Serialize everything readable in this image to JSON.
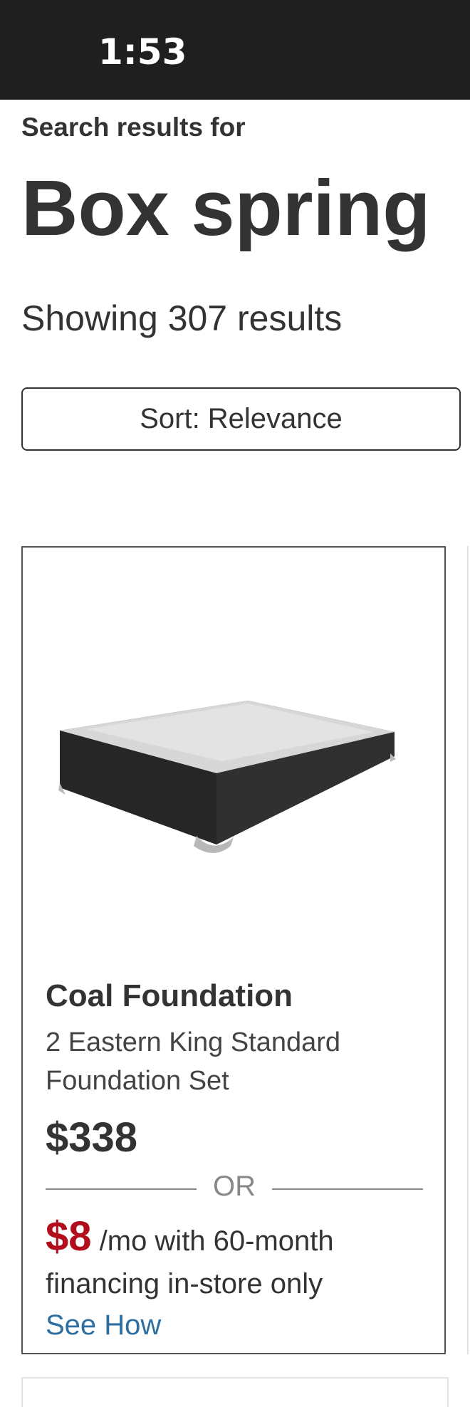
{
  "status_bar": {
    "time": "1:53"
  },
  "search": {
    "label": "Search results for",
    "query": "Box spring",
    "result_count": "Showing 307 results"
  },
  "sort": {
    "label": "Sort: Relevance"
  },
  "products": [
    {
      "name": "Coal Foundation",
      "description": "2 Eastern King Standard Foundation Set",
      "price": "$338",
      "or_text": "OR",
      "monthly_price": "$8",
      "financing_text": " /mo with 60-month financing in-store only",
      "see_how": "See How",
      "image_icon": "box-spring-foundation"
    }
  ],
  "colors": {
    "status_bar": "#1f1f1f",
    "text": "#333333",
    "financing_price": "#b10d1c",
    "link": "#2c6ea0"
  }
}
